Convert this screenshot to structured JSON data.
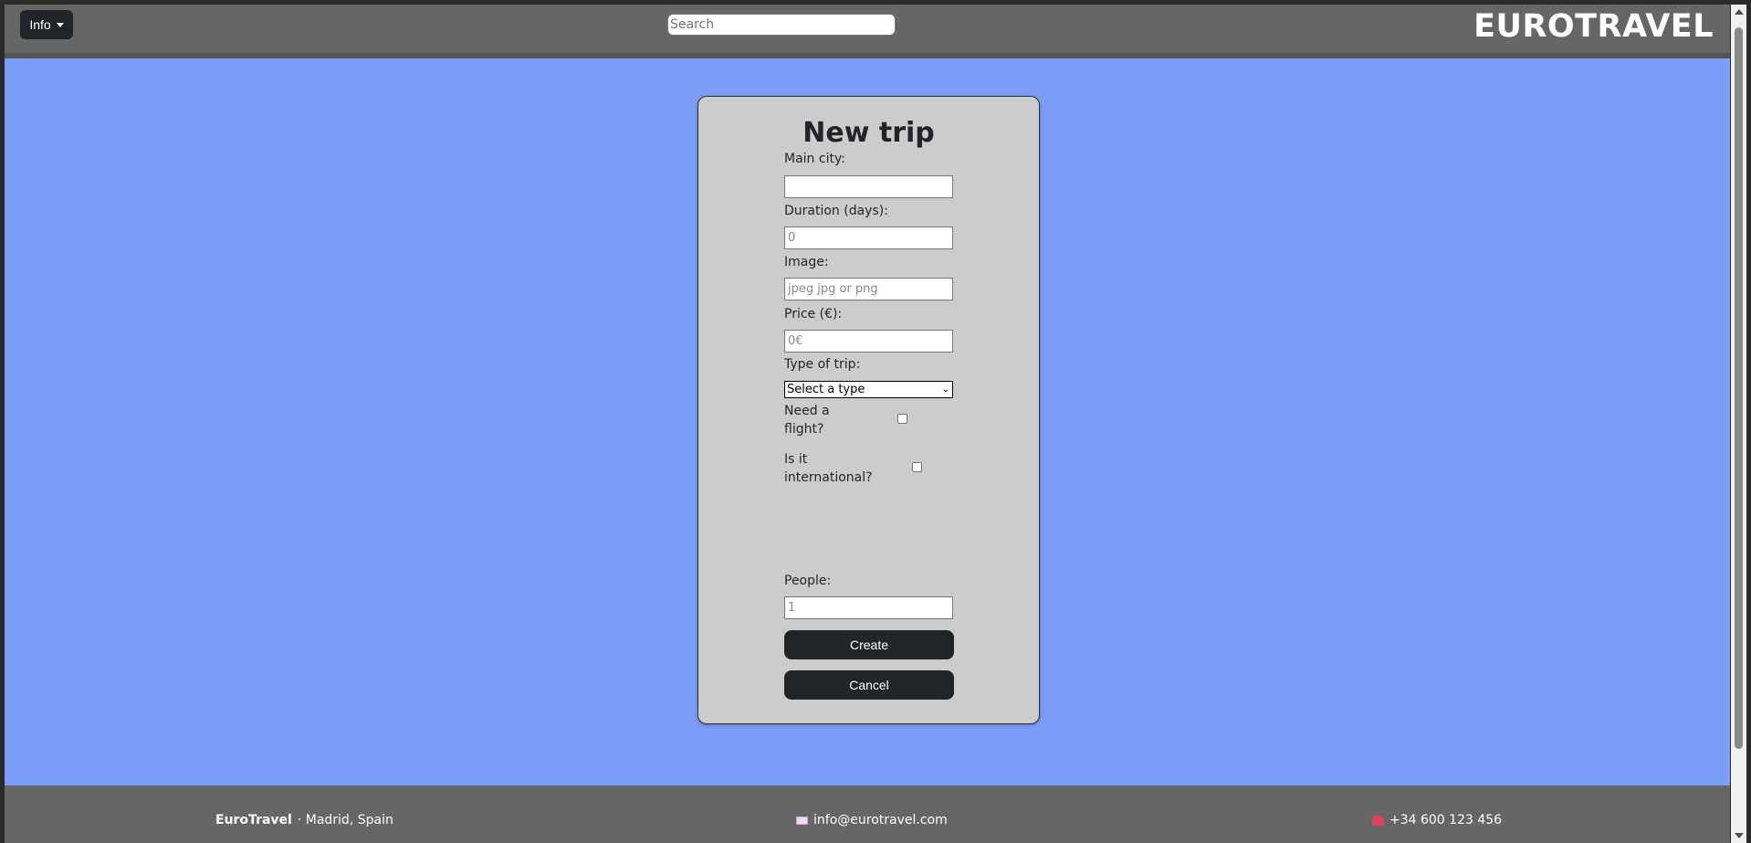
{
  "navbar": {
    "info_label": "Info",
    "search_placeholder": "Search",
    "brand": "EUROTRAVEL"
  },
  "form": {
    "title": "New trip",
    "main_city_label": "Main city:",
    "main_city_value": "",
    "duration_label": "Duration (days):",
    "duration_placeholder": "0",
    "image_label": "Image:",
    "image_placeholder": "jpeg jpg or png",
    "price_label": "Price (€):",
    "price_placeholder": "0€",
    "type_label": "Type of trip:",
    "type_selected": "Select a type",
    "flight_label_1": "Need a",
    "flight_label_2": "flight?",
    "flight_checked": false,
    "international_label_1": "Is it",
    "international_label_2": "international?",
    "international_checked": false,
    "people_label": "People:",
    "people_placeholder": "1",
    "create_label": "Create",
    "cancel_label": "Cancel"
  },
  "footer": {
    "company": "EuroTravel",
    "location": "· Madrid, Spain",
    "email": "info@eurotravel.com",
    "phone": "+34 600 123 456"
  },
  "colors": {
    "page_background": "#7b9cf7",
    "navbar": "#666666",
    "card": "#cccccc",
    "button": "#212529"
  }
}
